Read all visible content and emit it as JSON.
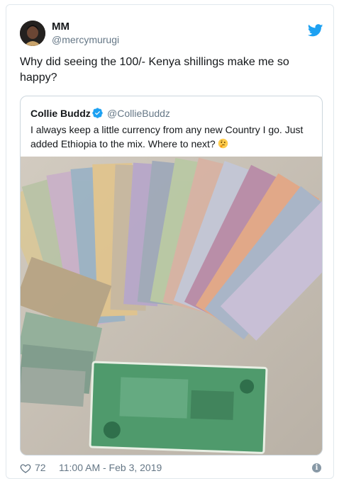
{
  "tweet": {
    "display_name": "MM",
    "handle": "@mercymurugi",
    "text": "Why did seeing the 100/- Kenya shillings make me so happy?",
    "likes": "72",
    "timestamp": "11:00 AM - Feb 3, 2019"
  },
  "quoted_tweet": {
    "display_name": "Collie Buddz",
    "handle": "@CollieBuddz",
    "text": "I always keep a little currency from any new Country I go. Just added Ethiopia to the mix. Where to next?",
    "emoji": "thinking-face-icon"
  },
  "colors": {
    "twitter_blue": "#1da1f2",
    "secondary_text": "#657786",
    "border": "#e1e8ed"
  },
  "icons": [
    "twitter-bird-icon",
    "verified-badge-icon",
    "heart-icon",
    "info-icon",
    "thinking-face-icon"
  ]
}
